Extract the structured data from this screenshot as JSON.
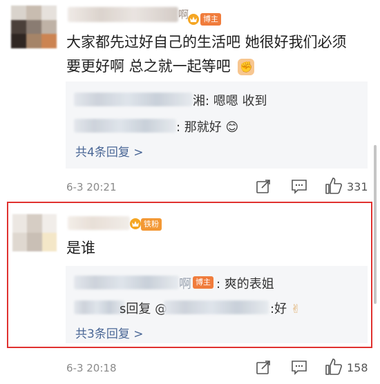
{
  "comments": [
    {
      "badge": "博主",
      "text_line1": "大家都先过好自己的生活吧 她很好我们必须",
      "text_line2": "要更好啊 总之就一起等吧",
      "emoji_fist": "✊",
      "replies": [
        {
          "text": "湘: 嗯嗯 收到"
        },
        {
          "text": ": 那就好",
          "emoji": "😊"
        }
      ],
      "more_replies": "共4条回复 >",
      "time": "6-3 20:21",
      "like_count": "331"
    },
    {
      "badge": "铁粉",
      "text": "是谁",
      "replies": [
        {
          "name_tail": "啊",
          "badge": "博主",
          "text": ": 爽的表姐"
        },
        {
          "prefix": "s回复 @",
          "text": ":好",
          "emoji": "✌"
        }
      ],
      "more_replies": "共3条回复 >",
      "time": "6-3 20:18",
      "like_count": "158"
    }
  ],
  "icons": {
    "share": "share-icon",
    "comment": "comment-icon",
    "like": "thumbs-up-icon",
    "vip": "vip-crown-icon"
  },
  "colors": {
    "highlight": "#e0312f",
    "link": "#4a6796",
    "owner_badge": "#f07c3c"
  }
}
